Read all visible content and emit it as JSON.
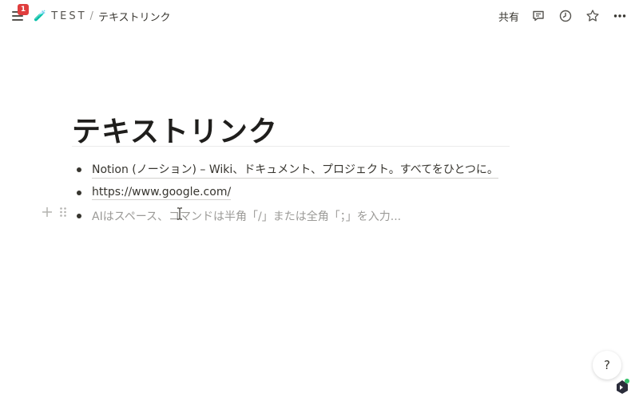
{
  "topbar": {
    "notification_count": "1",
    "breadcrumb": {
      "page_icon": "🧪",
      "workspace": "TEST",
      "separator": "/",
      "page": "テキストリンク"
    },
    "share_label": "共有",
    "icons": [
      "comment-icon",
      "history-icon",
      "star-icon",
      "more-icon"
    ]
  },
  "page": {
    "title": "テキストリンク",
    "items": [
      {
        "text": "Notion (ノーション) – Wiki、ドキュメント、プロジェクト。すべてをひとつに。"
      },
      {
        "text": "https://www.google.com/"
      }
    ],
    "placeholder": "AIはスペース、コマンドは半角「/」または全角「；」を入力..."
  },
  "help": {
    "label": "?"
  }
}
